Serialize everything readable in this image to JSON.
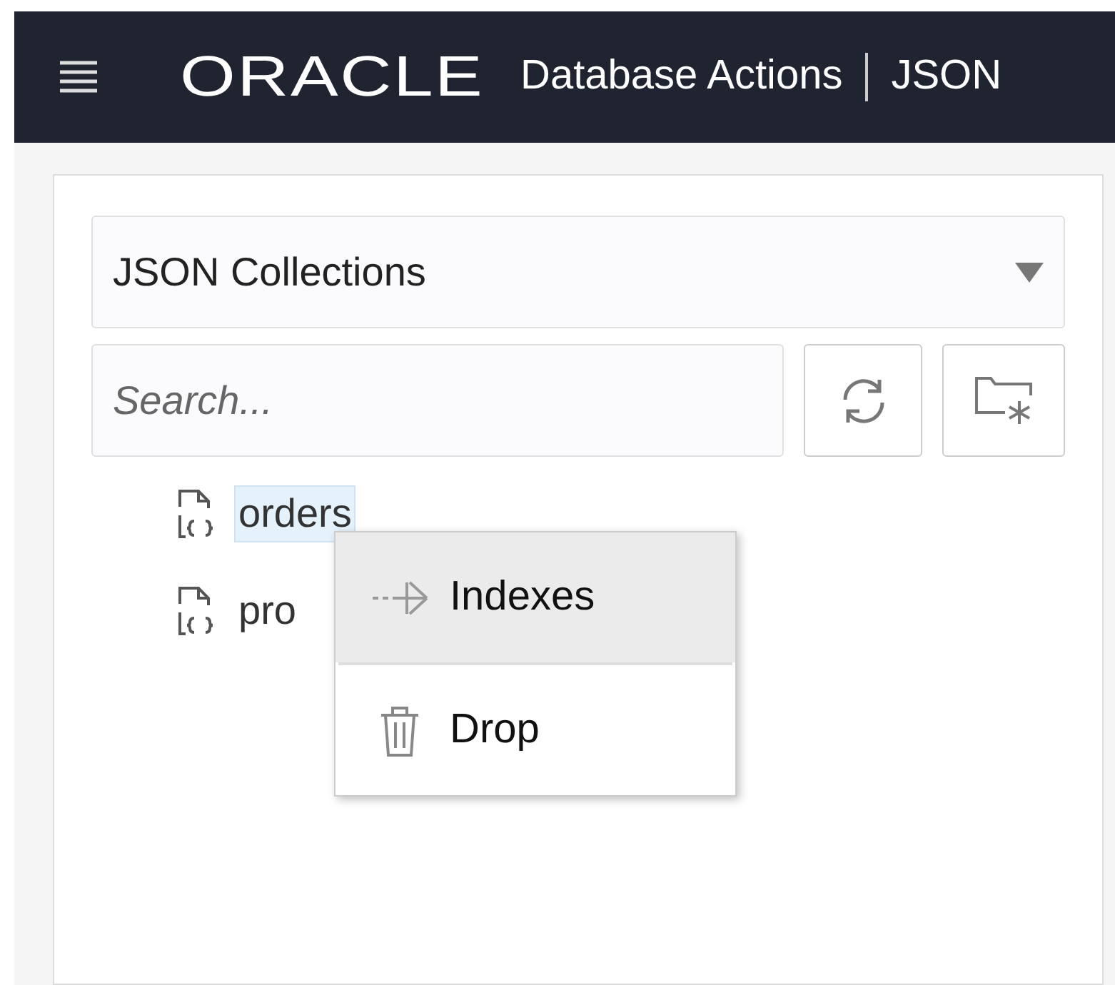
{
  "header": {
    "logo": "ORACLE",
    "title": "Database Actions",
    "section": "JSON"
  },
  "collection_type": {
    "value": "JSON Collections"
  },
  "search": {
    "placeholder": "Search..."
  },
  "collections": [
    {
      "name": "orders",
      "selected": true
    },
    {
      "name": "pro",
      "selected": false
    }
  ],
  "context_menu": [
    {
      "kind": "indexes",
      "label": "Indexes",
      "selected": true
    },
    {
      "kind": "drop",
      "label": "Drop",
      "selected": false
    }
  ]
}
